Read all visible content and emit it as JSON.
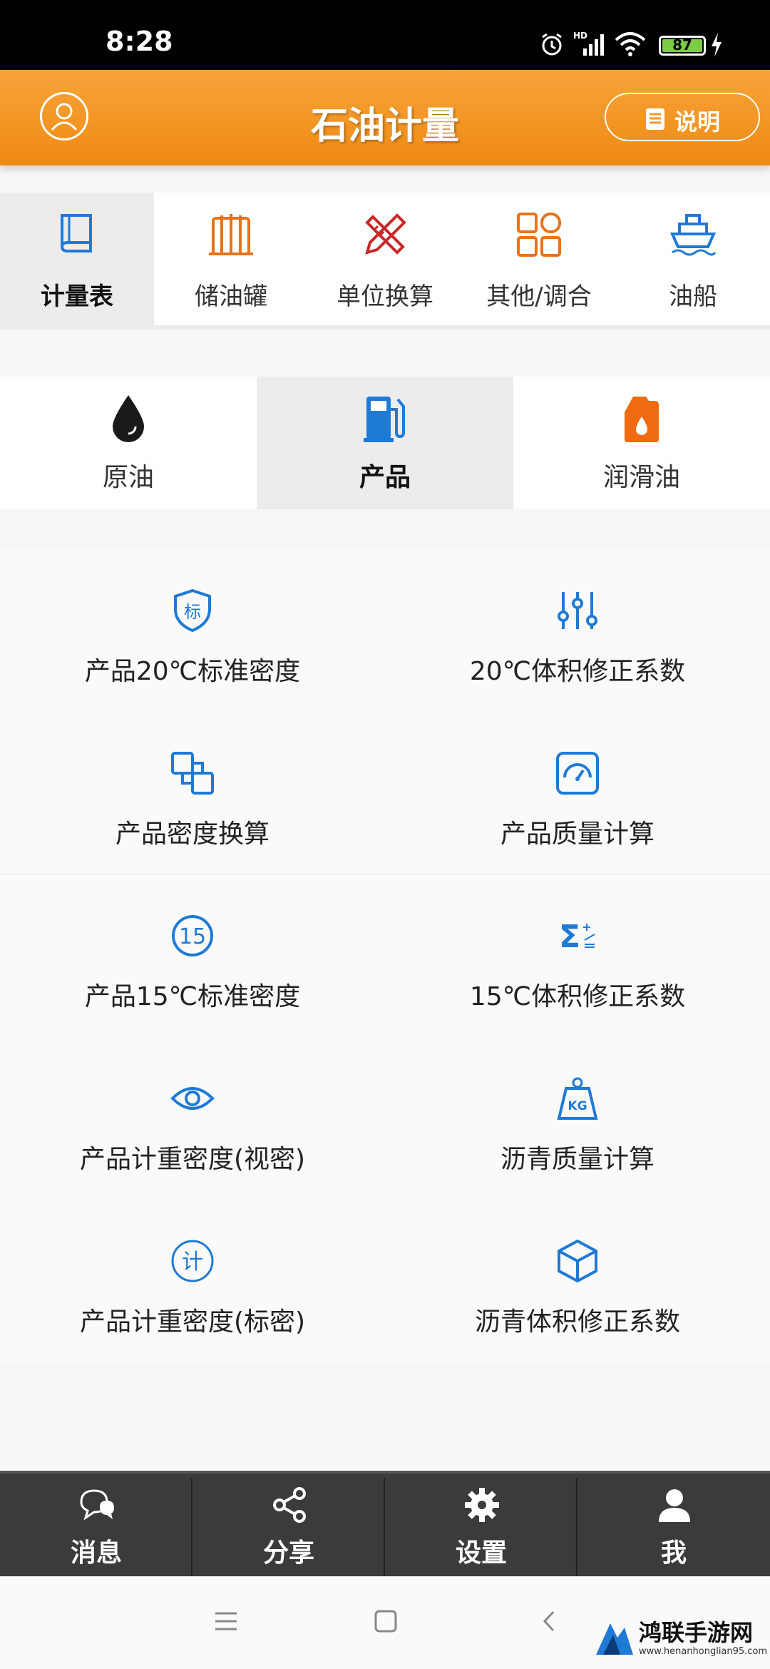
{
  "status_bar": {
    "time": "8:28",
    "battery": "87",
    "icons": [
      "alarm-icon",
      "hd-signal-icon",
      "wifi-icon",
      "battery-icon",
      "charging-icon"
    ]
  },
  "header": {
    "title": "石油计量",
    "help_label": "说明",
    "background_color": "#f39a25"
  },
  "top_categories": [
    {
      "label": "计量表",
      "icon": "book-icon",
      "color": "#1f7ad6",
      "active": true
    },
    {
      "label": "储油罐",
      "icon": "tank-icon",
      "color": "#e8731a",
      "active": false
    },
    {
      "label": "单位换算",
      "icon": "ruler-pencil-icon",
      "color": "#c62828",
      "active": false
    },
    {
      "label": "其他/调合",
      "icon": "grid-icon",
      "color": "#e8731a",
      "active": false
    },
    {
      "label": "油船",
      "icon": "ship-icon",
      "color": "#1f7ad6",
      "active": false
    }
  ],
  "product_types": [
    {
      "label": "原油",
      "icon": "oil-drop-icon",
      "color": "#1a1a1a",
      "active": false
    },
    {
      "label": "产品",
      "icon": "fuel-pump-icon",
      "color": "#1f7ad6",
      "active": true
    },
    {
      "label": "润滑油",
      "icon": "oil-can-icon",
      "color": "#f06a10",
      "active": false
    }
  ],
  "functions": [
    {
      "label": "产品20℃标准密度",
      "icon": "shield-standard-icon",
      "glyph": "标"
    },
    {
      "label": "20℃体积修正系数",
      "icon": "sliders-icon",
      "glyph": ""
    },
    {
      "label": "产品密度换算",
      "icon": "convert-squares-icon",
      "glyph": ""
    },
    {
      "label": "产品质量计算",
      "icon": "gauge-icon",
      "glyph": ""
    },
    {
      "label": "产品15℃标准密度",
      "icon": "circle-15-icon",
      "glyph": "15"
    },
    {
      "label": "15℃体积修正系数",
      "icon": "sigma-icon",
      "glyph": "Σ"
    },
    {
      "label": "产品计重密度(视密)",
      "icon": "eye-icon",
      "glyph": ""
    },
    {
      "label": "沥青质量计算",
      "icon": "kg-weight-icon",
      "glyph": "KG"
    },
    {
      "label": "产品计重密度(标密)",
      "icon": "circle-ji-icon",
      "glyph": "计"
    },
    {
      "label": "沥青体积修正系数",
      "icon": "cube-icon",
      "glyph": ""
    }
  ],
  "bottom_tabs": [
    {
      "label": "消息",
      "icon": "chat-icon"
    },
    {
      "label": "分享",
      "icon": "share-icon"
    },
    {
      "label": "设置",
      "icon": "gear-icon"
    },
    {
      "label": "我",
      "icon": "person-icon"
    }
  ],
  "watermark": {
    "main": "鸿联手游网",
    "sub": "www.henanhonglian95.com"
  }
}
